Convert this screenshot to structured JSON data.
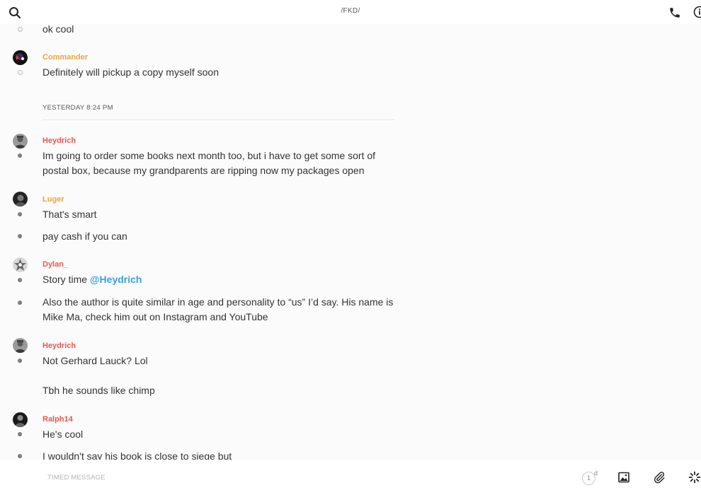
{
  "header": {
    "title": "/FKD/",
    "icons": [
      "search-icon",
      "phone-icon",
      "info-icon"
    ]
  },
  "messages": [
    {
      "author": "",
      "text": "ok cool"
    },
    {
      "author": "Commander",
      "color": "#f0a43a",
      "text": "Definitely will pickup a copy myself soon"
    },
    {
      "divider": "YESTERDAY 8:24 PM"
    },
    {
      "author": "Heydrich",
      "color": "#e3594f",
      "text": "Im going to order some books next month too, but i have to get some sort of postal box, because my grandparents are ripping now my packages open"
    },
    {
      "author": "Luger",
      "color": "#f0a43a",
      "text": "That's smart"
    },
    {
      "author": "",
      "text": "pay cash if you can"
    },
    {
      "author": "Dylan_",
      "color": "#e3594f",
      "text_before": "Story time ",
      "mention": "@Heydrich"
    },
    {
      "author": "",
      "text": "Also the author is quite similar in age and personality to “us” I’d say. His name is Mike Ma, check him out on Instagram and YouTube"
    },
    {
      "author": "Heydrich",
      "color": "#e3594f",
      "text": "Not Gerhard Lauck? Lol"
    },
    {
      "author": "",
      "text": "Tbh he sounds like chimp"
    },
    {
      "author": "Ralph14",
      "color": "#e3594f",
      "text": "He's cool"
    },
    {
      "author": "",
      "text": "I wouldn't say his book is close to siege but"
    }
  ],
  "composer": {
    "placeholder": "TIMED MESSAGE",
    "timer_value": "1",
    "timer_unit": "d",
    "icons": [
      "timer-icon",
      "image-icon",
      "paperclip-icon",
      "spinner-icon"
    ]
  },
  "colors": {
    "name_red": "#e3594f",
    "name_orange": "#f0a43a",
    "mention_blue": "#3aa0d8",
    "background": "#fbfbfb"
  }
}
